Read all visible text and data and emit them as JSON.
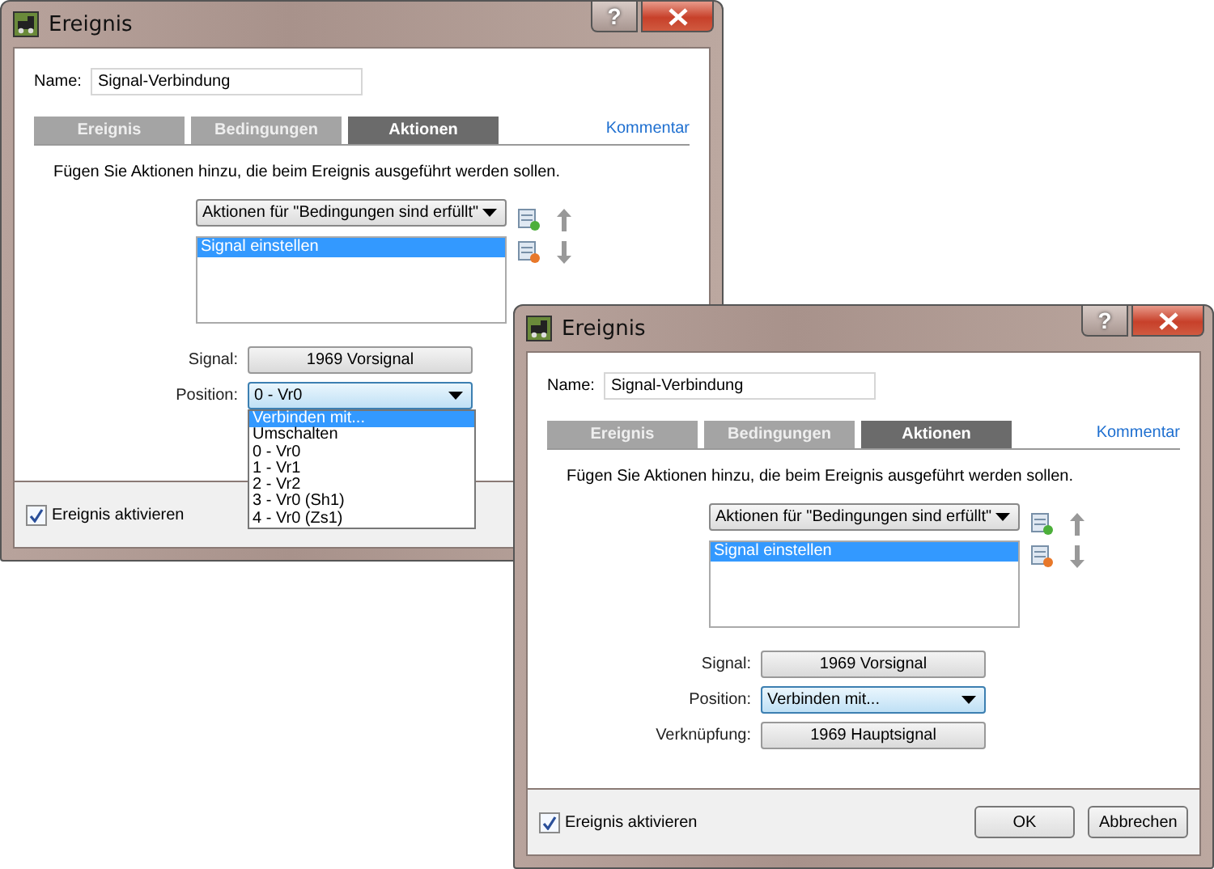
{
  "windows": [
    {
      "title": "Ereignis",
      "help": "?",
      "name_label": "Name:",
      "name_value": "Signal-Verbindung",
      "tabs": [
        {
          "label": "Ereignis",
          "selected": false
        },
        {
          "label": "Bedingungen",
          "selected": false
        },
        {
          "label": "Aktionen",
          "selected": true
        }
      ],
      "comment_link": "Kommentar",
      "instruction": "Fügen Sie Aktionen hinzu, die beim Ereignis ausgeführt werden sollen.",
      "action_set": "Aktionen für \"Bedingungen sind erfüllt\"",
      "actions": [
        {
          "label": "Signal einstellen",
          "selected": true
        }
      ],
      "fields": [
        {
          "kind": "button",
          "label": "Signal:",
          "value": "1969 Vorsignal"
        },
        {
          "kind": "select",
          "label": "Position:",
          "value": "0 - Vr0",
          "options": [
            {
              "label": "Verbinden mit...",
              "highlighted": true
            },
            {
              "label": "Umschalten",
              "highlighted": false
            },
            {
              "label": "0 - Vr0",
              "highlighted": false
            },
            {
              "label": "1 - Vr1",
              "highlighted": false
            },
            {
              "label": "2 - Vr2",
              "highlighted": false
            },
            {
              "label": "3 - Vr0 (Sh1)",
              "highlighted": false
            },
            {
              "label": "4 - Vr0 (Zs1)",
              "highlighted": false
            }
          ]
        }
      ],
      "enable": {
        "label": "Ereignis aktivieren",
        "checked": true
      }
    },
    {
      "title": "Ereignis",
      "help": "?",
      "name_label": "Name:",
      "name_value": "Signal-Verbindung",
      "tabs": [
        {
          "label": "Ereignis",
          "selected": false
        },
        {
          "label": "Bedingungen",
          "selected": false
        },
        {
          "label": "Aktionen",
          "selected": true
        }
      ],
      "comment_link": "Kommentar",
      "instruction": "Fügen Sie Aktionen hinzu, die beim Ereignis ausgeführt werden sollen.",
      "action_set": "Aktionen für \"Bedingungen sind erfüllt\"",
      "actions": [
        {
          "label": "Signal einstellen",
          "selected": true
        }
      ],
      "fields": [
        {
          "kind": "button",
          "label": "Signal:",
          "value": "1969 Vorsignal"
        },
        {
          "kind": "select",
          "label": "Position:",
          "value": "Verbinden mit..."
        },
        {
          "kind": "button",
          "label": "Verknüpfung:",
          "value": "1969 Hauptsignal"
        }
      ],
      "enable": {
        "label": "Ereignis aktivieren",
        "checked": true
      },
      "buttons": [
        "OK",
        "Abbrechen"
      ]
    }
  ]
}
